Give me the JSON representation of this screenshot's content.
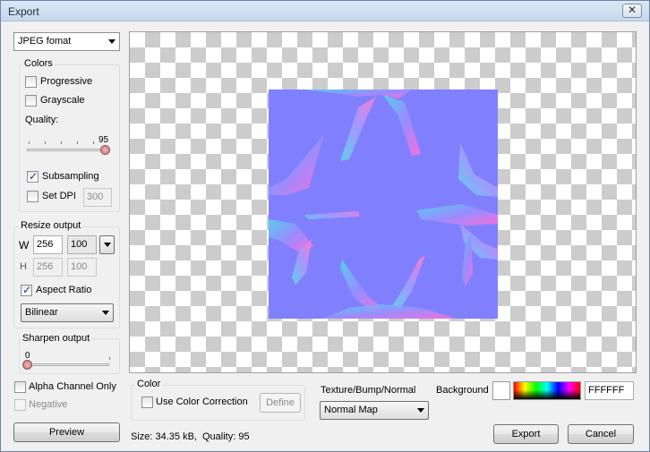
{
  "window": {
    "title": "Export",
    "close_glyph": "✕"
  },
  "format": {
    "selected": "JPEG fomat"
  },
  "colors_group": {
    "label": "Colors",
    "progressive": {
      "label": "Progressive",
      "checked": false
    },
    "grayscale": {
      "label": "Grayscale",
      "checked": false
    },
    "quality_label": "Quality:",
    "quality_value": "95",
    "quality_level": 95,
    "subsampling": {
      "label": "Subsampling",
      "checked": true
    },
    "set_dpi": {
      "label": "Set DPI",
      "checked": false,
      "value": "300"
    }
  },
  "resize_group": {
    "label": "Resize output",
    "w_label": "W",
    "w_value": "256",
    "w_percent": "100",
    "h_label": "H",
    "h_value": "256",
    "h_percent": "100",
    "aspect_ratio": {
      "label": "Aspect Ratio",
      "checked": true
    },
    "filter": "Bilinear"
  },
  "sharpen_group": {
    "label": "Sharpen output",
    "value": "0",
    "level": 0
  },
  "alpha_channel_only": {
    "label": "Alpha Channel Only",
    "checked": false
  },
  "negative": {
    "label": "Negative",
    "checked": false,
    "disabled": true
  },
  "preview_button": "Preview",
  "color_group": {
    "label": "Color",
    "use_color_correction": {
      "label": "Use Color Correction",
      "checked": false
    },
    "define_button": "Define"
  },
  "texture": {
    "label": "Texture/Bump/Normal",
    "selected": "Normal Map"
  },
  "background": {
    "label": "Background",
    "hex": "FFFFFF",
    "swatch_color": "#ffffff"
  },
  "status": {
    "size": "Size: 34.35 kB,",
    "quality": "Quality: 95"
  },
  "export_button": "Export",
  "cancel_button": "Cancel",
  "colors": {
    "normal_map_base": "#8080ff",
    "checker_dark": "#cccccc",
    "checker_light": "#ffffff"
  },
  "icons": {
    "close": "close-icon",
    "dropdown": "chevron-down-icon",
    "checkmark": "checkmark-icon"
  }
}
